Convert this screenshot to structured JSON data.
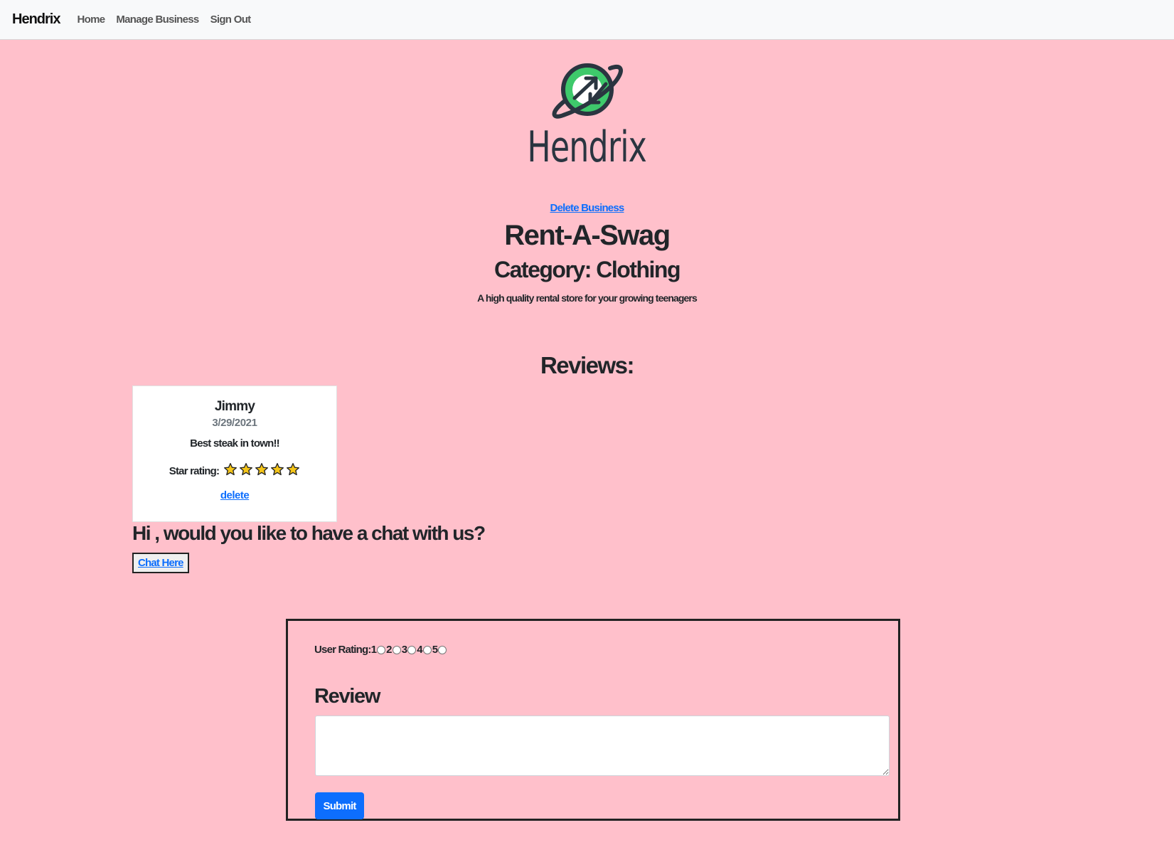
{
  "navbar": {
    "brand": "Hendrix",
    "links": [
      "Home",
      "Manage Business",
      "Sign Out"
    ]
  },
  "logo": {
    "text": "Hendrix",
    "icon": "planet-exchange-icon",
    "colors": {
      "green": "#3ec96b",
      "outline": "#2a3540"
    }
  },
  "business": {
    "delete_label": "Delete Business",
    "name": "Rent-A-Swag",
    "category": "Category: Clothing",
    "description": "A high quality rental store for your growing teenagers"
  },
  "reviews": {
    "heading": "Reviews:",
    "items": [
      {
        "name": "Jimmy",
        "date": "3/29/2021",
        "text": "Best steak in town!!",
        "star_label": "Star rating:",
        "stars": 5,
        "delete_label": "delete"
      }
    ]
  },
  "chat": {
    "heading": "Hi , would you like to have a chat with us?",
    "button_label": "Chat Here"
  },
  "review_form": {
    "rating_label": "User Rating:",
    "rating_options": [
      "1",
      "2",
      "3",
      "4",
      "5"
    ],
    "review_label": "Review",
    "textarea_value": "",
    "submit_label": "Submit"
  },
  "colors": {
    "background": "#ffc0cb",
    "link": "#0d6efd",
    "navbar": "#f8f9fa",
    "star": "#f5c518"
  }
}
